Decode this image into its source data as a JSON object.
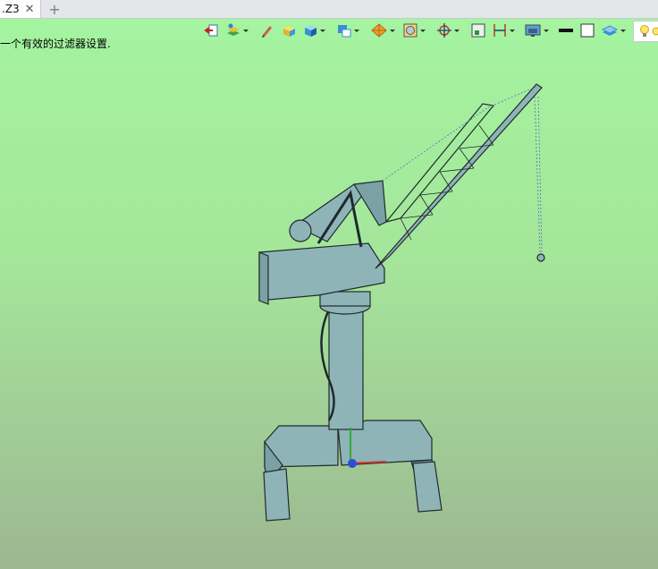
{
  "tab": {
    "label": ".Z3",
    "close_icon": "close-icon",
    "add_icon": "plus-icon"
  },
  "viewport": {
    "message": "一个有效的过滤器设置.",
    "background_top": "#a4f4a0",
    "background_bottom": "#9cb791"
  },
  "toolbar": {
    "buttons": [
      "exit-view-icon",
      "layers-icon",
      "pen-icon",
      "shaded-box-icon",
      "cube-view-icon",
      "view-orientation-icon",
      "render-sphere-icon",
      "display-filter-icon",
      "snap-point-icon",
      "select-frame-icon",
      "dimension-icon",
      "screen-color-icon",
      "black-line-icon",
      "white-square-icon",
      "layer-stack-icon",
      "light-bulb-icon"
    ]
  },
  "model": {
    "name": "portal-crane",
    "color": "#8fb4b8",
    "edge_color": "#1f2a2c"
  }
}
